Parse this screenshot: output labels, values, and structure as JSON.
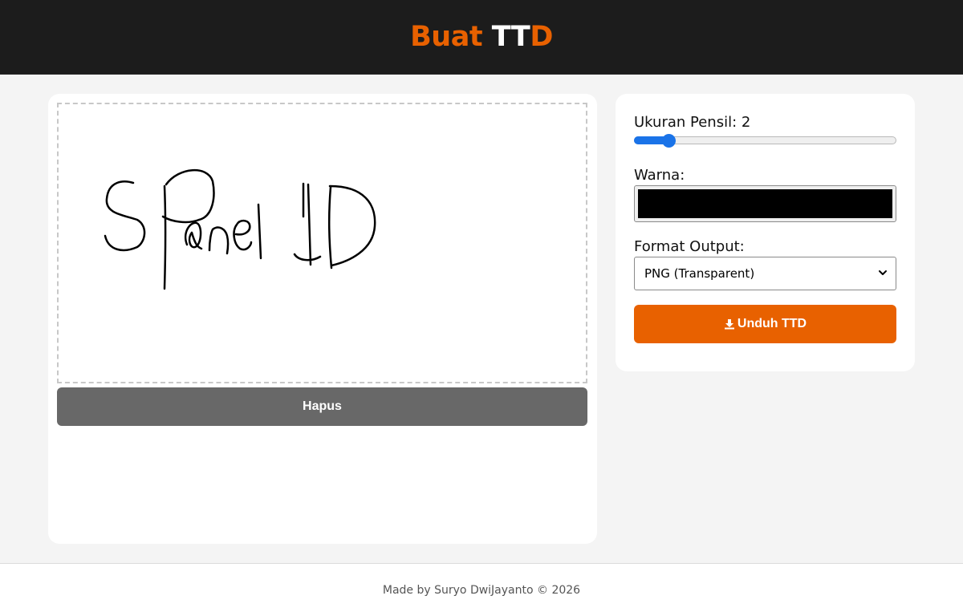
{
  "header": {
    "title_part1": "Buat ",
    "title_part2": "TT",
    "title_part3": "D",
    "accent_color": "#e86100"
  },
  "canvas": {
    "stroke_color": "#000000",
    "clear_label": "Hapus"
  },
  "controls": {
    "pencil_size_label": "Ukuran Pensil: 2",
    "pencil_size_value": 2,
    "pencil_size_fraction": 0.13,
    "color_label": "Warna:",
    "color_value": "#000000",
    "format_label": "Format Output:",
    "format_selected": "PNG (Transparent)",
    "download_label": "Unduh TTD"
  },
  "footer": {
    "text": "Made by Suryo DwiJayanto © 2026"
  }
}
